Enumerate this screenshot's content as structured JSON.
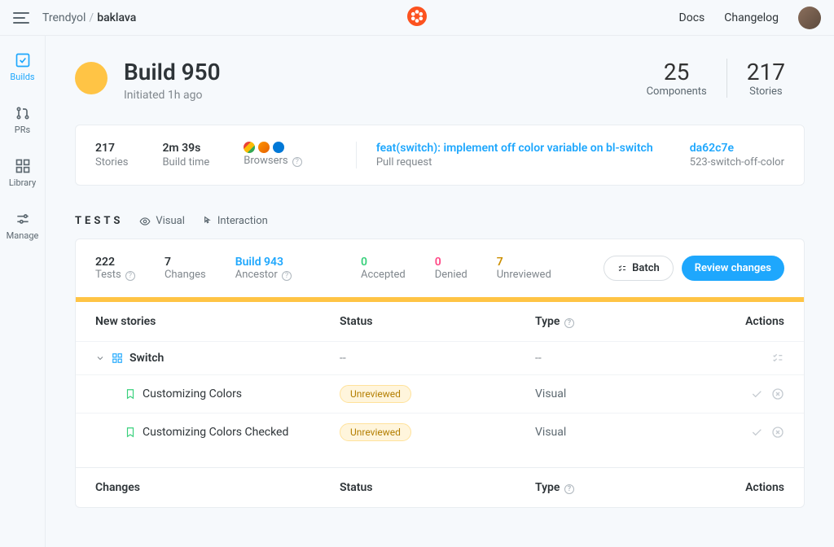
{
  "topbar": {
    "org": "Trendyol",
    "repo": "baklava",
    "docs": "Docs",
    "changelog": "Changelog"
  },
  "sidebar": {
    "builds": "Builds",
    "prs": "PRs",
    "library": "Library",
    "manage": "Manage"
  },
  "header": {
    "title": "Build 950",
    "subtitle": "Initiated 1h ago",
    "components_num": "25",
    "components_lbl": "Components",
    "stories_num": "217",
    "stories_lbl": "Stories"
  },
  "buildinfo": {
    "stories_val": "217",
    "stories_lbl": "Stories",
    "buildtime_val": "2m 39s",
    "buildtime_lbl": "Build time",
    "browsers_lbl": "Browsers",
    "pr_title": "feat(switch): implement off color variable on bl-switch",
    "pr_lbl": "Pull request",
    "commit_hash": "da62c7e",
    "branch": "523-switch-off-color"
  },
  "tests": {
    "title": "TESTS",
    "tab_visual": "Visual",
    "tab_interaction": "Interaction",
    "tests_val": "222",
    "tests_lbl": "Tests",
    "changes_val": "7",
    "changes_lbl": "Changes",
    "ancestor_val": "Build 943",
    "ancestor_lbl": "Ancestor",
    "accepted_val": "0",
    "accepted_lbl": "Accepted",
    "denied_val": "0",
    "denied_lbl": "Denied",
    "unreviewed_val": "7",
    "unreviewed_lbl": "Unreviewed",
    "batch_btn": "Batch",
    "review_btn": "Review changes"
  },
  "table": {
    "head_name": "New stories",
    "head_status": "Status",
    "head_type": "Type",
    "head_actions": "Actions",
    "group_switch": "Switch",
    "dash": "--",
    "story1": "Customizing Colors",
    "story2": "Customizing Colors Checked",
    "badge_unreviewed": "Unreviewed",
    "type_visual": "Visual",
    "head2_name": "Changes"
  }
}
